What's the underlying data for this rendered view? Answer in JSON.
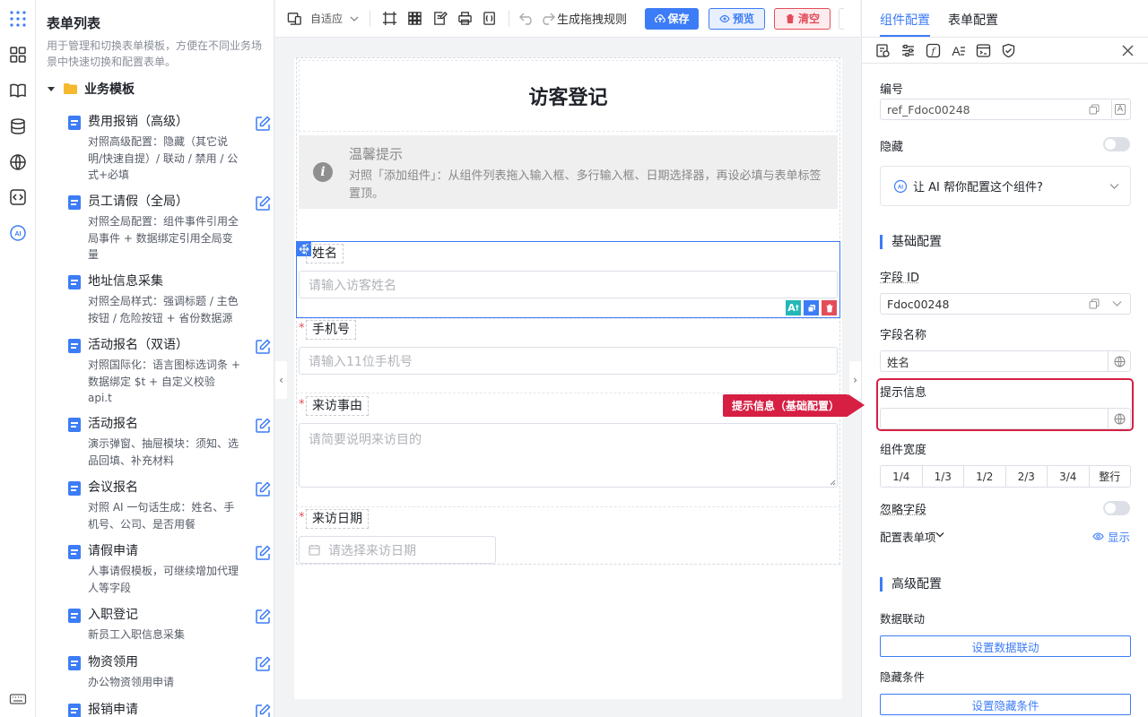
{
  "sidebar": {
    "title": "表单列表",
    "description": "用于管理和切换表单模板，方便在不同业务场景中快速切换和配置表单。",
    "group": "业务模板",
    "templates": [
      {
        "name": "费用报销（高级）",
        "desc": "对照高级配置：隐藏（其它说明/快速自提）/ 联动 / 禁用 / 公式+必填"
      },
      {
        "name": "员工请假（全局）",
        "desc": "对照全局配置：组件事件引用全局事件 + 数据绑定引用全局变量"
      },
      {
        "name": "地址信息采集",
        "desc": "对照全局样式：强调标题 / 主色按钮 / 危险按钮 + 省份数据源"
      },
      {
        "name": "活动报名（双语）",
        "desc": "对照国际化：语言图标选词条 + 数据绑定 $t + 自定义校验 api.t"
      },
      {
        "name": "活动报名",
        "desc": "演示弹窗、抽屉模块：须知、选品回填、补充材料"
      },
      {
        "name": "会议报名",
        "desc": "对照 AI 一句话生成：姓名、手机号、公司、是否用餐"
      },
      {
        "name": "请假申请",
        "desc": "人事请假模板，可继续增加代理人等字段"
      },
      {
        "name": "入职登记",
        "desc": "新员工入职信息采集"
      },
      {
        "name": "物资领用",
        "desc": "办公物资领用申请"
      },
      {
        "name": "报销申请",
        "desc": ""
      }
    ]
  },
  "toolbar": {
    "adaptive": "自适应",
    "rules": "生成拖拽规则",
    "save": "保存",
    "preview": "预览",
    "clear": "清空"
  },
  "form": {
    "title": "访客登记",
    "tip_title": "温馨提示",
    "tip_text": "对照「添加组件」：从组件列表拖入输入框、多行输入框、日期选择器，再设必填与表单标签置顶。",
    "fields": [
      {
        "label": "姓名",
        "placeholder": "请输入访客姓名",
        "required": false
      },
      {
        "label": "手机号",
        "placeholder": "请输入11位手机号",
        "required": true
      },
      {
        "label": "来访事由",
        "placeholder": "请简要说明来访目的",
        "required": true
      },
      {
        "label": "来访日期",
        "placeholder": "请选择来访日期",
        "required": true
      }
    ],
    "required_mark": "*"
  },
  "panel": {
    "tab_component": "组件配置",
    "tab_form": "表单配置",
    "id_label": "编号",
    "id_value": "ref_Fdoc00248",
    "hidden_label": "隐藏",
    "ai_prompt": "让 AI 帮你配置这个组件?",
    "basic_section": "基础配置",
    "field_id_label": "字段 ID",
    "field_id_value": "Fdoc00248",
    "field_name_label": "字段名称",
    "field_name_value": "姓名",
    "hint_label": "提示信息",
    "hint_value": "",
    "width_label": "组件宽度",
    "widths": [
      "1/4",
      "1/3",
      "1/2",
      "2/3",
      "3/4",
      "整行"
    ],
    "ignore_label": "忽略字段",
    "config_items_label": "配置表单项",
    "show_label": "显示",
    "advanced_section": "高级配置",
    "linkage_label": "数据联动",
    "linkage_button": "设置数据联动",
    "hide_cond_label": "隐藏条件",
    "hide_cond_button": "设置隐藏条件"
  },
  "callout": "提示信息（基础配置）",
  "colors": {
    "primary": "#3c7cf6",
    "danger": "#e34d59",
    "callout": "#d61f43"
  }
}
